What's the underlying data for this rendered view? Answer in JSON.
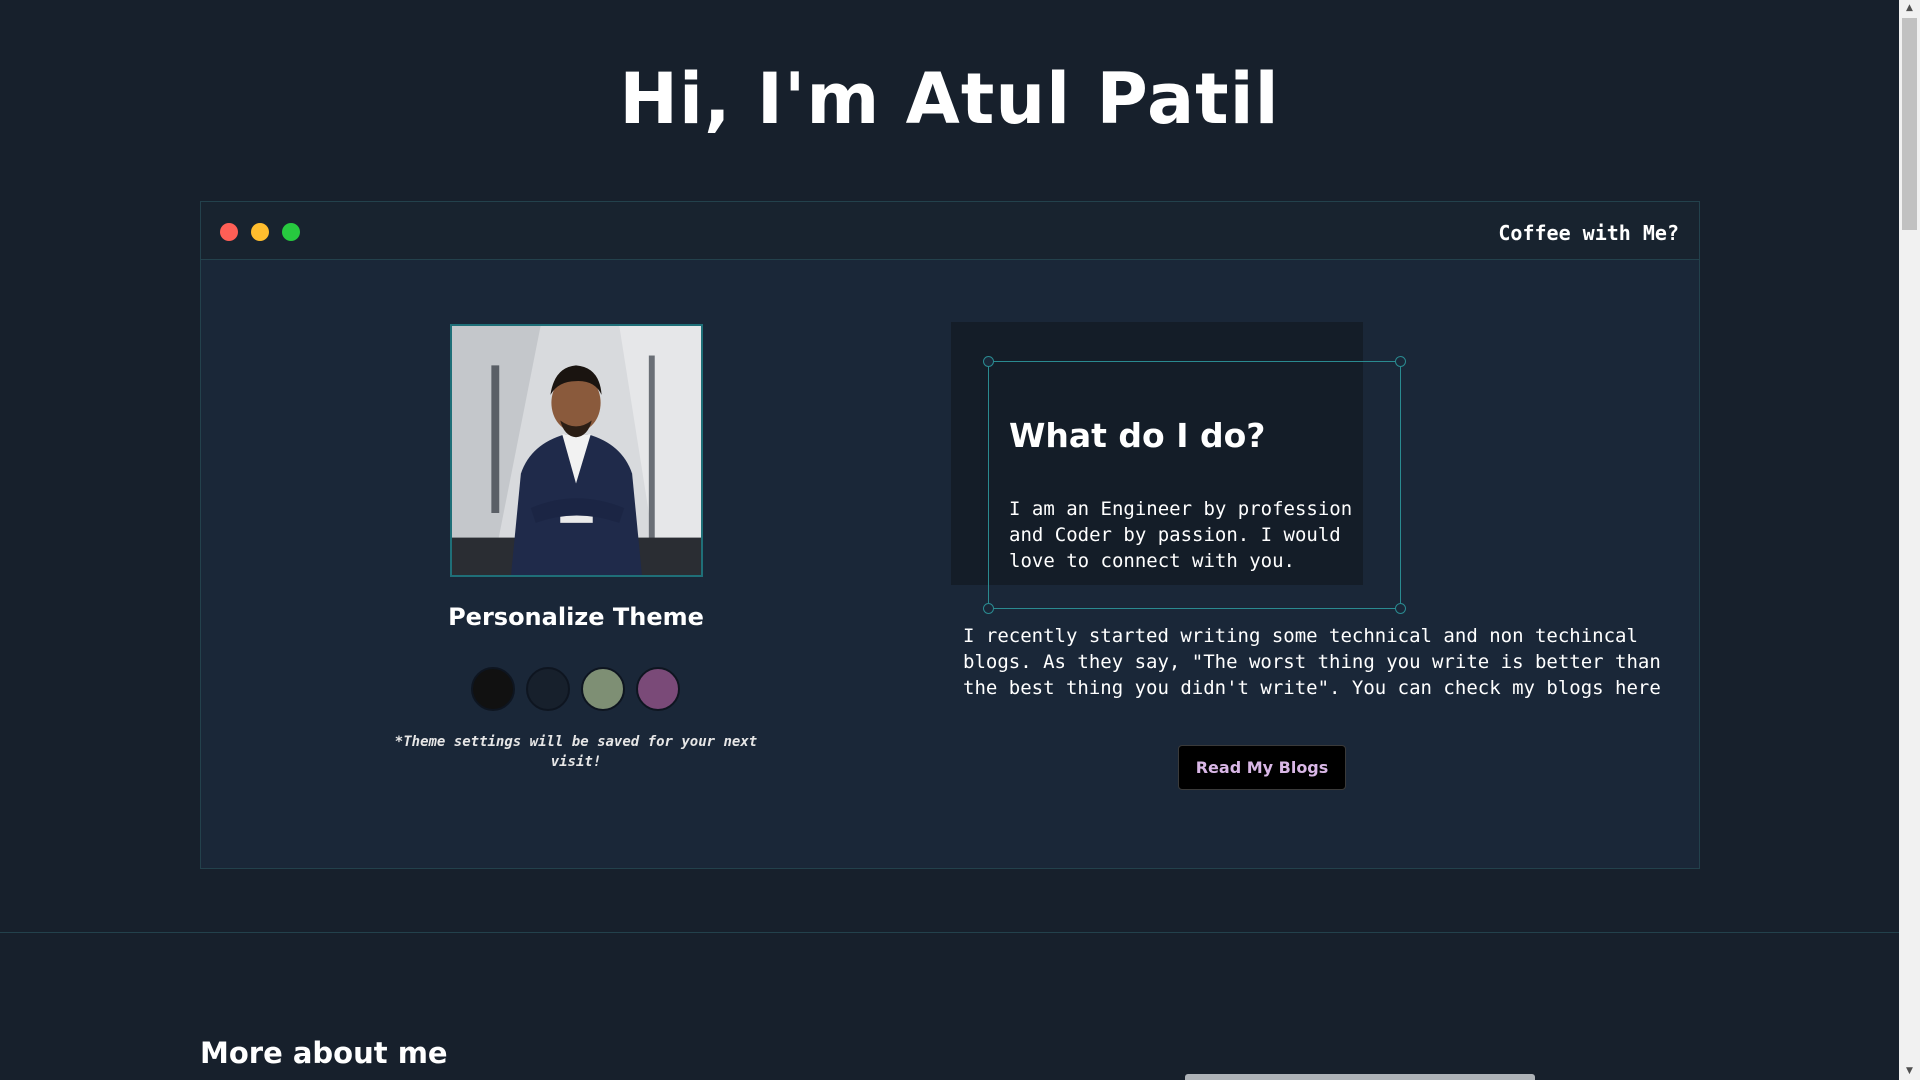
{
  "hero": {
    "title": "Hi, I'm Atul Patil"
  },
  "window": {
    "coffee_link": "Coffee with Me?"
  },
  "profile": {
    "theme_title": "Personalize Theme",
    "swatches": [
      {
        "name": "black",
        "color": "#111111"
      },
      {
        "name": "navy",
        "color": "#17202c"
      },
      {
        "name": "sage",
        "color": "#7e8f74"
      },
      {
        "name": "plum",
        "color": "#7a4a78"
      }
    ],
    "theme_note": "*Theme settings will be saved for your next visit!"
  },
  "about_card": {
    "title": "What do I do?",
    "text": "I am an Engineer by profession and Coder by passion. I would love to connect with you."
  },
  "blogs": {
    "text": "I recently started writing some technical and non techincal blogs. As they say, \"The worst thing you write is better than the best thing you didn't write\". You can check my blogs here",
    "button_label": "Read My Blogs"
  },
  "more": {
    "title": "More about me"
  },
  "colors": {
    "background": "#17202c",
    "window_bg": "#1a2738",
    "accent": "#2a8a90",
    "button_text": "#d9b7e6"
  },
  "icons": {
    "window_controls": [
      "close-dot-icon",
      "minimize-dot-icon",
      "maximize-dot-icon"
    ]
  }
}
